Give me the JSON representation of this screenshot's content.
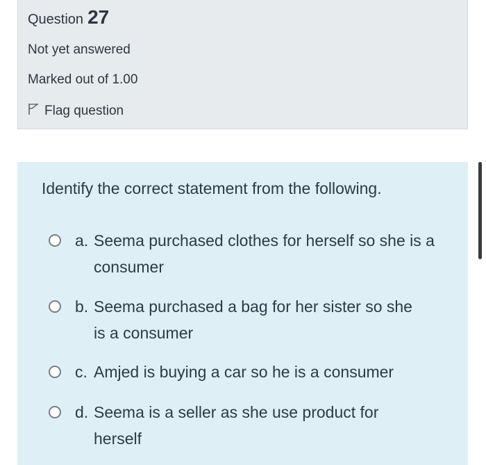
{
  "info": {
    "question_label": "Question",
    "question_number": "27",
    "status": "Not yet answered",
    "marks": "Marked out of 1.00",
    "flag_label": "Flag question"
  },
  "question": {
    "text": "Identify the correct statement from the following.",
    "options": [
      {
        "letter": "a.",
        "text": "Seema purchased clothes for herself so she is a consumer"
      },
      {
        "letter": "b.",
        "text": "Seema purchased a bag for her sister so she is a consumer"
      },
      {
        "letter": "c.",
        "text": "Amjed is buying a car so he is a consumer"
      },
      {
        "letter": "d.",
        "text": "Seema is a seller as she use product for herself"
      }
    ]
  },
  "icons": {
    "flag": "flag-icon",
    "radio": "radio-icon"
  },
  "colors": {
    "info_bg": "#e8ebee",
    "formulation_bg": "#def0f6",
    "text": "#2c3a47"
  }
}
